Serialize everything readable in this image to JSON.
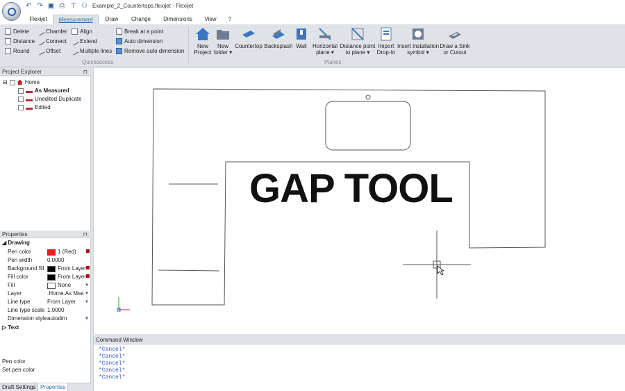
{
  "window": {
    "title": "Example_2_Countertops.flexijet - Flexijet"
  },
  "quick_access": {
    "icons": [
      "undo-icon",
      "redo-icon",
      "save-icon",
      "print-icon",
      "filter-icon",
      "camera-icon"
    ],
    "glyphs": [
      "↶",
      "↷",
      "▣",
      "⎙",
      "⊤",
      "⚇"
    ]
  },
  "tabs": [
    {
      "label": "Flexijet"
    },
    {
      "label": "Measurement"
    },
    {
      "label": "Draw"
    },
    {
      "label": "Change"
    },
    {
      "label": "Dimensions"
    },
    {
      "label": "View"
    },
    {
      "label": "?"
    }
  ],
  "ribbon": {
    "quickaccess": {
      "col1": [
        "Delete",
        "Distance",
        "Round"
      ],
      "col2": [
        "Chamfer",
        "Connect",
        "Offset"
      ],
      "col3": [
        "Align",
        "Extend",
        "Multiple lines"
      ],
      "col4": [
        "Break at a point",
        "Auto dimension",
        "Remove auto dimension"
      ],
      "group_label": "Quickaccess"
    },
    "planes": {
      "buttons": [
        {
          "line1": "New",
          "line2": "Project"
        },
        {
          "line1": "New",
          "line2": "folder ▾"
        },
        {
          "line1": "Countertop",
          "line2": ""
        },
        {
          "line1": "Backsplash",
          "line2": ""
        },
        {
          "line1": "Wall",
          "line2": ""
        },
        {
          "line1": "Horizontal",
          "line2": "plane ▾"
        },
        {
          "line1": "Distance point",
          "line2": "to plane ▾"
        },
        {
          "line1": "Import",
          "line2": "Drop-In"
        },
        {
          "line1": "Insert installation",
          "line2": "symbol ▾"
        },
        {
          "line1": "Draw a Sink",
          "line2": "or Cutout"
        }
      ],
      "group_label": "Planes"
    }
  },
  "project_explorer": {
    "title": "Project Explorer",
    "pin": "📌",
    "items": [
      {
        "label": "Home"
      },
      {
        "label": "As Measured"
      },
      {
        "label": "Unedited Duplicate"
      },
      {
        "label": "Edited"
      }
    ]
  },
  "properties": {
    "title": "Properties",
    "pin": "📌",
    "category": "Drawing",
    "rows": [
      {
        "key": "Pen color",
        "value": "1 (Red)",
        "swatch": "#e0241b"
      },
      {
        "key": "Pen width",
        "value": "0.0000"
      },
      {
        "key": "Background fill",
        "value": "From Layer",
        "swatch": "#000000"
      },
      {
        "key": "Fill color",
        "value": "From Layer",
        "swatch": "#000000"
      },
      {
        "key": "Fill",
        "value": "None",
        "swatch": "#ffffff"
      },
      {
        "key": "Layer",
        "value": ".Home.As Measured"
      },
      {
        "key": "Line type",
        "value": "From Layer"
      },
      {
        "key": "Line type scale",
        "value": "1.0000"
      },
      {
        "key": "Dimension style",
        "value": "autodim"
      }
    ],
    "category2": "Text",
    "desc_title": "Pen color",
    "desc_text": "Set pen color"
  },
  "bottom_tabs": [
    "Draft Settings",
    "Properties"
  ],
  "canvas": {
    "overlay_text": "GAP TOOL"
  },
  "command_window": {
    "title": "Command Window",
    "lines": [
      "*Cancel*",
      "*Cancel*",
      "*Cancel*",
      "*Cancel*",
      "*Cancel*"
    ]
  },
  "colors": {
    "accent": "#2e6fb5",
    "ribbon_bg": "#dfe3e8",
    "command_text": "#3454c4",
    "red_marker": "#9b1b1b"
  }
}
